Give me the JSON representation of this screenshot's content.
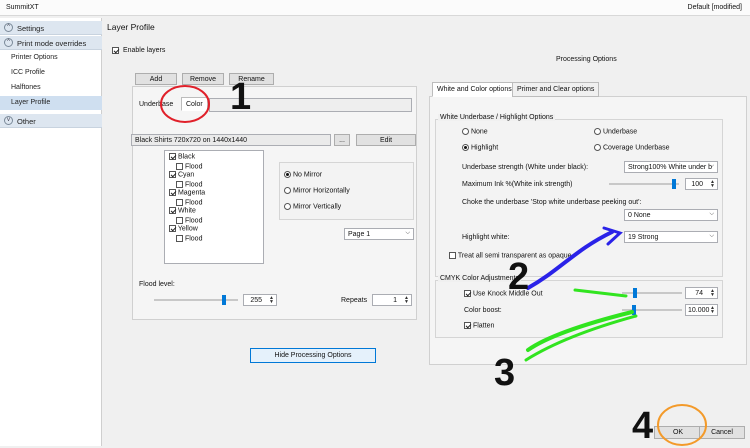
{
  "window": {
    "app_name": "SummitXT",
    "status": "Default [modified]"
  },
  "sidebar": {
    "sections": [
      {
        "label": "Settings",
        "chevron": "^"
      },
      {
        "label": "Print mode overrides",
        "chevron": "^"
      },
      {
        "label": "Other",
        "chevron": "v"
      }
    ],
    "items": [
      {
        "label": "Printer Options"
      },
      {
        "label": "ICC Profile"
      },
      {
        "label": "Halftones"
      },
      {
        "label": "Layer Profile"
      }
    ]
  },
  "page": {
    "title": "Layer Profile",
    "enable_layers_label": "Enable layers",
    "processing_options_label": "Processing Options"
  },
  "layers": {
    "add_label": "Add",
    "remove_label": "Remove",
    "rename_label": "Rename",
    "tabs": [
      "Underbase",
      "Color"
    ],
    "file_value": "Black Shirts 720x720 on 1440x1440",
    "browse_label": "...",
    "edit_label": "Edit",
    "channels": [
      {
        "label": "Black",
        "checked": true
      },
      {
        "label": "Flood",
        "checked": false
      },
      {
        "label": "Cyan",
        "checked": true
      },
      {
        "label": "Flood",
        "checked": false
      },
      {
        "label": "Magenta",
        "checked": true
      },
      {
        "label": "Flood",
        "checked": false
      },
      {
        "label": "White",
        "checked": true
      },
      {
        "label": "Flood",
        "checked": false
      },
      {
        "label": "Yellow",
        "checked": true
      },
      {
        "label": "Flood",
        "checked": false
      }
    ],
    "mirror": [
      "No Mirror",
      "Mirror Horizontally",
      "Mirror Vertically"
    ],
    "page_value": "Page 1",
    "flood_level_label": "Flood level:",
    "flood_level_value": "255",
    "flood_level_fraction": 0.85,
    "repeats_label": "Repeats",
    "repeats_value": "1",
    "hide_processing_label": "Hide Processing Options"
  },
  "processing": {
    "tabs": [
      "White and Color options",
      "Primer and Clear options"
    ],
    "white_group_title": "White Underbase / Highlight Options",
    "radios": [
      "None",
      "Underbase",
      "Highlight",
      "Coverage Underbase"
    ],
    "underbase_strength_label": "Underbase strength (White under black):",
    "underbase_strength_value": "Strong100% White under b",
    "max_ink_label": "Maximum Ink %(White ink strength)",
    "max_ink_value": "100",
    "max_ink_fraction": 0.95,
    "choke_label": "Choke the underbase 'Stop white underbase peeking out':",
    "choke_value": "0 None",
    "highlight_white_label": "Highlight white:",
    "highlight_white_value": "19 Strong",
    "treat_transparent_label": "Treat all semi transparent as opaque.",
    "cmyk_group_title": "CMYK Color Adjustments",
    "knockout_label": "Use Knock Middle Out",
    "knockout_value": "74",
    "knockout_fraction": 0.2,
    "color_boost_label": "Color boost:",
    "color_boost_value": "10.000",
    "color_boost_fraction": 0.18,
    "flatten_label": "Flatten"
  },
  "footer": {
    "ok_label": "OK",
    "cancel_label": "Cancel"
  },
  "annotations": [
    "1",
    "2",
    "3",
    "4"
  ],
  "colors": {
    "accent": "#0078d7",
    "red_circle": "#e0202a",
    "blue_arrow": "#2a22e8",
    "green_arrow": "#31e41f",
    "orange_circle": "#f39a2a"
  }
}
